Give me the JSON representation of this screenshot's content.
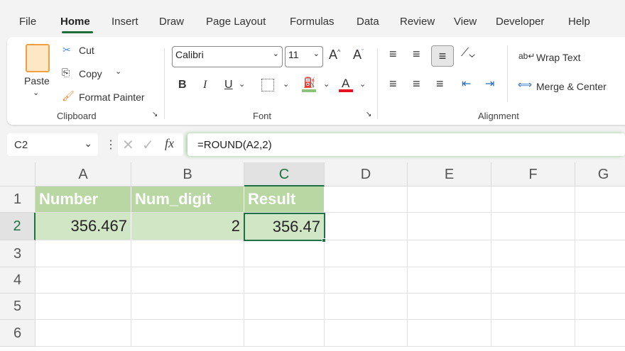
{
  "menu": {
    "tabs": [
      "File",
      "Home",
      "Insert",
      "Draw",
      "Page Layout",
      "Formulas",
      "Data",
      "Review",
      "View",
      "Developer",
      "Help"
    ],
    "active": "Home"
  },
  "ribbon": {
    "clipboard": {
      "paste": "Paste",
      "cut": "Cut",
      "copy": "Copy",
      "format_painter": "Format Painter",
      "label": "Clipboard"
    },
    "font": {
      "name": "Calibri",
      "size": "11",
      "bold": "B",
      "italic": "I",
      "underline": "U",
      "label": "Font",
      "fill_color": "#8cc37b",
      "font_color": "#e81123"
    },
    "alignment": {
      "wrap_text": "Wrap Text",
      "merge_center": "Merge & Center",
      "label": "Alignment"
    }
  },
  "formula_bar": {
    "name_box": "C2",
    "fx": "fx",
    "formula": "=ROUND(A2,2)"
  },
  "sheet": {
    "columns": [
      "A",
      "B",
      "C",
      "D",
      "E",
      "F",
      "G"
    ],
    "rows": [
      "1",
      "2",
      "3",
      "4",
      "5",
      "6"
    ],
    "headers": [
      "Number",
      "Num_digit",
      "Result"
    ],
    "values": [
      "356.467",
      "2",
      "356.47"
    ],
    "selected": "C2",
    "accent": "#1e7145"
  }
}
